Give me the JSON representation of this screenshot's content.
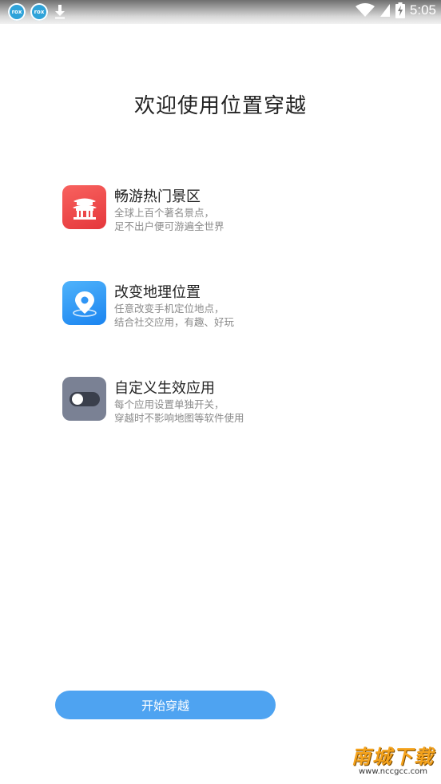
{
  "status_bar": {
    "notif_icon_label": "rox",
    "time": "5:05",
    "icons": [
      "app-notification-icon",
      "app-notification-icon",
      "download-icon",
      "wifi-icon",
      "signal-icon",
      "battery-charging-icon"
    ]
  },
  "page": {
    "title": "欢迎使用位置穿越"
  },
  "features": [
    {
      "icon": "palace-icon",
      "title": "畅游热门景区",
      "desc_line1": "全球上百个著名景点，",
      "desc_line2": "足不出户便可游遍全世界"
    },
    {
      "icon": "location-pin-icon",
      "title": "改变地理位置",
      "desc_line1": "任意改变手机定位地点，",
      "desc_line2": "结合社交应用，有趣、好玩"
    },
    {
      "icon": "toggle-switch-icon",
      "title": "自定义生效应用",
      "desc_line1": "每个应用设置单独开关，",
      "desc_line2": "穿越时不影响地图等软件使用"
    }
  ],
  "start_button": {
    "label": "开始穿越"
  },
  "watermark": {
    "logo": "南城下载",
    "url": "www.nccgcc.com"
  },
  "colors": {
    "primary_button": "#4ea3f1",
    "scenic_icon": "#ef4a4c",
    "location_icon": "#2f95f5",
    "toggle_icon": "#7a8194",
    "title_text": "#222222",
    "desc_text": "#8a8a8a",
    "watermark": "#f4a21c"
  }
}
